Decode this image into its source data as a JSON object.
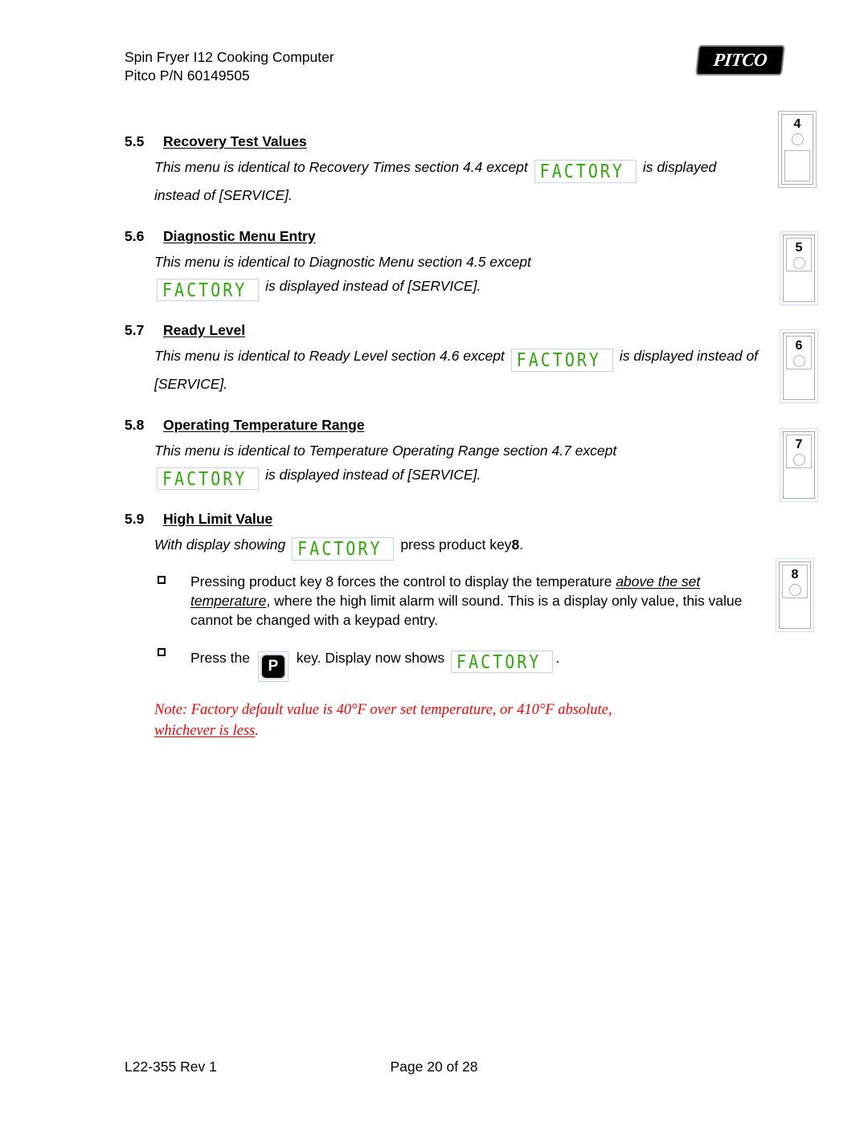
{
  "header": {
    "line1": "Spin Fryer I12 Cooking Computer",
    "line2": "Pitco P/N 60149505",
    "logo_text": "PITCO"
  },
  "display_text": "FACTORY",
  "sections": [
    {
      "number": "5.5",
      "title": "Recovery Test Values",
      "body_before": "This menu is identical to Recovery Times section 4.4 except",
      "body_after": "is displayed instead of [SERVICE]."
    },
    {
      "number": "5.6",
      "title": "Diagnostic Menu Entry",
      "body_before": "This menu is identical to Diagnostic Menu section 4.5 except",
      "body_after": "is displayed instead of [SERVICE]."
    },
    {
      "number": "5.7",
      "title": "Ready Level",
      "body_before": "This menu is identical to Ready Level section 4.6 except",
      "body_after": "is displayed instead of [SERVICE]."
    },
    {
      "number": "5.8",
      "title": "Operating Temperature Range",
      "body_before": "This menu is identical to Temperature Operating Range section 4.7 except",
      "body_after": "is displayed instead of [SERVICE]."
    },
    {
      "number": "5.9",
      "title": "High Limit Value",
      "body_before": "With display showing",
      "body_after": "press product key",
      "body_after_bold": "8",
      "body_after_tail": "."
    }
  ],
  "bullets": {
    "bullet1_part1": "Pressing product key 8 forces the control to display the temperature",
    "bullet1_emphasis": "above the set temperature",
    "bullet1_part2": ", where the high limit alarm will sound.  This is a display only value, this value cannot be changed with a keypad entry.",
    "bullet2_part1": "Press the",
    "bullet2_key": "P",
    "bullet2_part2": "key. Display now shows",
    "bullet2_tail": "."
  },
  "note": {
    "text1": "Note: Factory default value is 40°F over set temperature, or 410°F absolute,",
    "text2": "whichever is less",
    "text3": "."
  },
  "key_graphics": [
    {
      "number": "4"
    },
    {
      "number": "5"
    },
    {
      "number": "6"
    },
    {
      "number": "7"
    },
    {
      "number": "8"
    }
  ],
  "footer": {
    "left": "L22-355 Rev 1",
    "center": "Page 20 of 28"
  },
  "colors": {
    "led_green": "#2fa80a",
    "note_red": "#ff0000",
    "led_border": "#c3d4e8"
  }
}
